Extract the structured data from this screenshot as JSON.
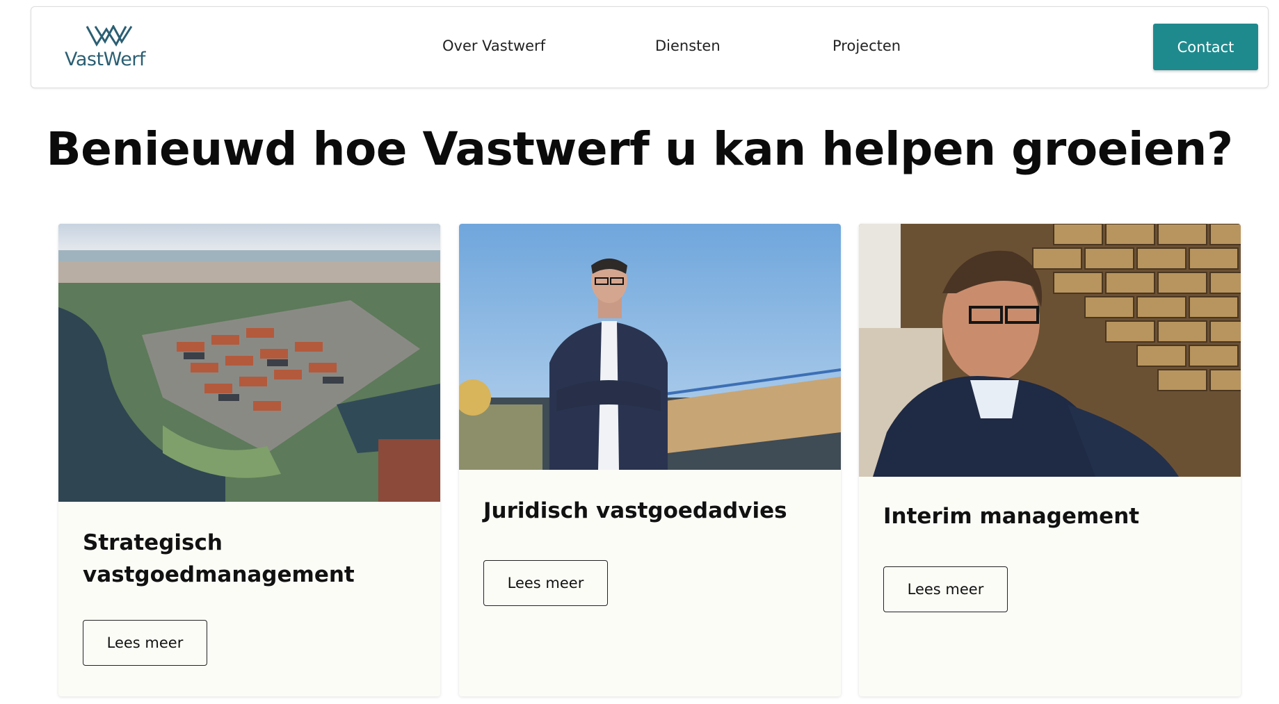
{
  "brand": {
    "logo_text": "VastWerf",
    "accent_color": "#1f8a8d",
    "logo_color": "#2b5f73"
  },
  "nav": {
    "items": [
      {
        "label": "Over Vastwerf"
      },
      {
        "label": "Diensten"
      },
      {
        "label": "Projecten"
      }
    ],
    "contact_label": "Contact"
  },
  "hero": {
    "headline": "Benieuwd hoe Vastwerf u kan helpen groeien?"
  },
  "cards": [
    {
      "title": "Strategisch vastgoedmanagement",
      "button_label": "Lees meer",
      "image": "aerial-residential-development-photo"
    },
    {
      "title": "Juridisch vastgoedadvies",
      "button_label": "Lees meer",
      "image": "man-in-blazer-harbor-photo"
    },
    {
      "title": "Interim management",
      "button_label": "Lees meer",
      "image": "man-with-glasses-brick-wall-photo"
    }
  ]
}
